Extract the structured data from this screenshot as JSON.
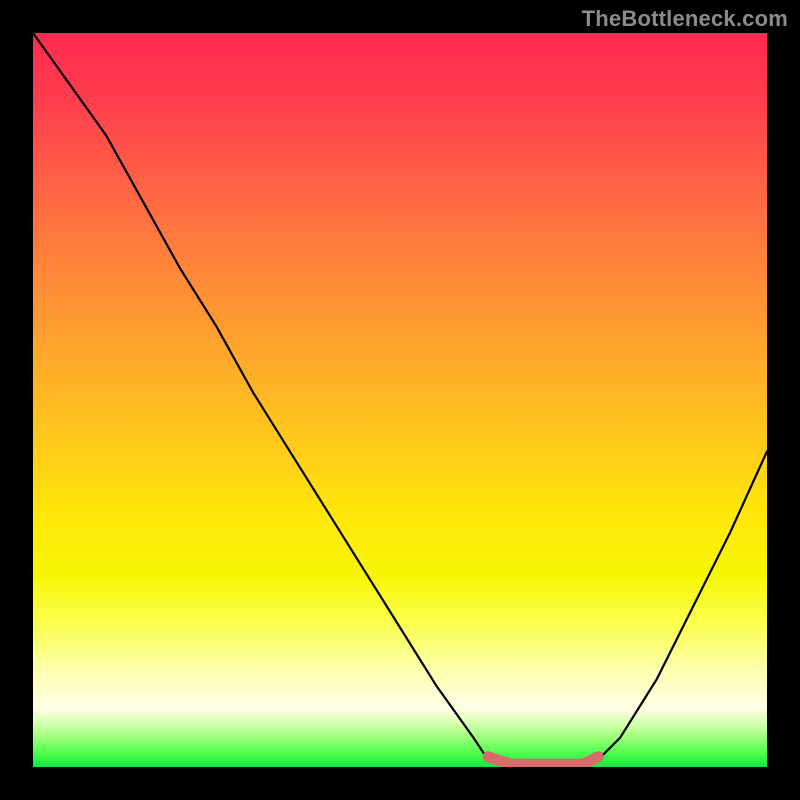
{
  "watermark": "TheBottleneck.com",
  "colors": {
    "bg": "#000000",
    "curve": "#000000",
    "highlight": "#d96b6b",
    "gradient_top": "#ff2b4f",
    "gradient_bottom": "#14e53c"
  },
  "chart_data": {
    "type": "line",
    "title": "",
    "xlabel": "",
    "ylabel": "",
    "xlim": [
      0,
      100
    ],
    "ylim": [
      0,
      100
    ],
    "x": [
      0,
      5,
      10,
      15,
      20,
      25,
      30,
      35,
      40,
      45,
      50,
      55,
      60,
      62,
      65,
      68,
      72,
      75,
      77,
      80,
      85,
      90,
      95,
      100
    ],
    "values": [
      100,
      93,
      86,
      77,
      68,
      60,
      51,
      43,
      35,
      27,
      19,
      11,
      4,
      1,
      0,
      0,
      0,
      0,
      1,
      4,
      12,
      22,
      32,
      43
    ],
    "annotations": [
      {
        "label": "valley-highlight",
        "x_start": 62,
        "x_end": 77,
        "y": 0.4
      }
    ]
  }
}
